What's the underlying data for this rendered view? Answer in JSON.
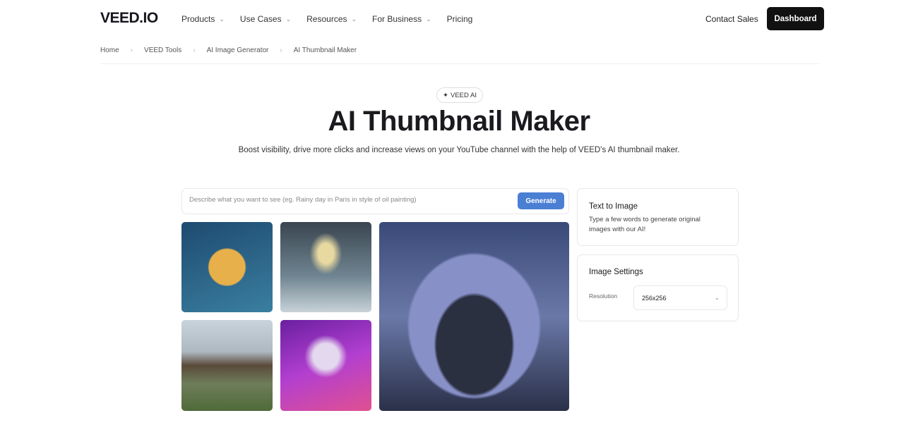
{
  "header": {
    "logo": "VEED.IO",
    "nav": [
      {
        "label": "Products",
        "dropdown": true
      },
      {
        "label": "Use Cases",
        "dropdown": true
      },
      {
        "label": "Resources",
        "dropdown": true
      },
      {
        "label": "For Business",
        "dropdown": true
      },
      {
        "label": "Pricing",
        "dropdown": false
      }
    ],
    "contact": "Contact Sales",
    "dashboard": "Dashboard"
  },
  "breadcrumb": [
    "Home",
    "VEED Tools",
    "AI Image Generator",
    "AI Thumbnail Maker"
  ],
  "hero": {
    "badge": "VEED AI",
    "badge_icon": "sparkle-icon",
    "title": "AI Thumbnail Maker",
    "subtitle": "Boost visibility, drive more clicks and increase views on your YouTube channel with the help of VEED's AI thumbnail maker."
  },
  "generator": {
    "placeholder": "Describe what you want to see (eg. Rainy day in Paris in style of oil painting)",
    "value": "",
    "button": "Generate",
    "accent": "#4a7fd4"
  },
  "gallery": [
    "cartoon-fish",
    "armored-warrior",
    "floating-house",
    "neon-panda",
    "glass-dome-building"
  ],
  "text_to_image": {
    "title": "Text to Image",
    "description": "Type a few words to generate original images with our AI!"
  },
  "settings": {
    "title": "Image Settings",
    "resolution_label": "Resolution",
    "resolution_value": "256x256"
  }
}
